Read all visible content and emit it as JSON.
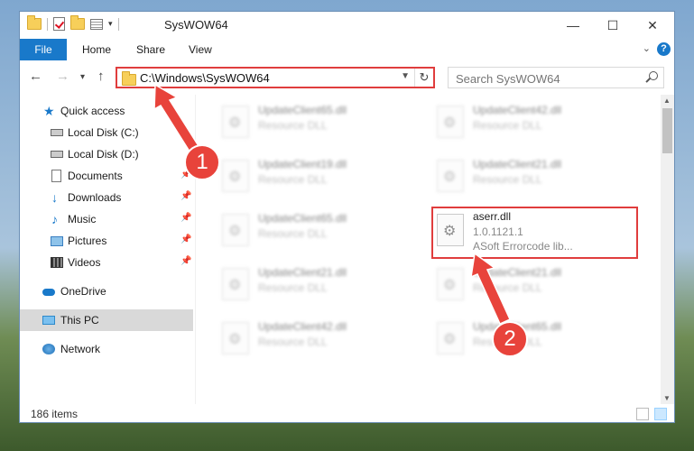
{
  "window": {
    "title": "SysWOW64",
    "controls": {
      "minimize": "—",
      "maximize": "☐",
      "close": "✕"
    }
  },
  "ribbon": {
    "tabs": [
      {
        "label": "File"
      },
      {
        "label": "Home"
      },
      {
        "label": "Share"
      },
      {
        "label": "View"
      }
    ],
    "help": "?"
  },
  "nav": {
    "address": "C:\\Windows\\SysWOW64",
    "search_placeholder": "Search SysWOW64"
  },
  "sidebar": {
    "items": [
      {
        "label": "Quick access",
        "icon": "star-icon"
      },
      {
        "label": "Local Disk (C:)",
        "icon": "drive-icon"
      },
      {
        "label": "Local Disk (D:)",
        "icon": "drive-icon"
      },
      {
        "label": "Documents",
        "icon": "documents-icon",
        "pinned": true
      },
      {
        "label": "Downloads",
        "icon": "download-icon",
        "pinned": true
      },
      {
        "label": "Music",
        "icon": "music-icon",
        "pinned": true
      },
      {
        "label": "Pictures",
        "icon": "pictures-icon",
        "pinned": true
      },
      {
        "label": "Videos",
        "icon": "videos-icon",
        "pinned": true
      },
      {
        "label": "OneDrive",
        "icon": "cloud-icon"
      },
      {
        "label": "This PC",
        "icon": "computer-icon",
        "selected": true
      },
      {
        "label": "Network",
        "icon": "network-icon"
      }
    ]
  },
  "files": [
    {
      "name": "UpdateClient65.dll",
      "type": "Resource DLL"
    },
    {
      "name": "UpdateClient42.dll",
      "type": "Resource DLL"
    },
    {
      "name": "UpdateClient19.dll",
      "type": "Resource DLL"
    },
    {
      "name": "UpdateClient21.dll",
      "type": "Resource DLL"
    },
    {
      "name": "UpdateClient65.dll",
      "type": "Resource DLL"
    },
    {
      "name": "aserr.dll",
      "version": "1.0.1121.1",
      "type": "ASoft Errorcode lib...",
      "highlighted": true
    },
    {
      "name": "UpdateClient21.dll",
      "type": "Resource DLL"
    },
    {
      "name": "UpdateClient21.dll",
      "type": "Resource DLL"
    },
    {
      "name": "UpdateClient42.dll",
      "type": "Resource DLL"
    },
    {
      "name": "UpdateClient65.dll",
      "type": "Resource DLL"
    }
  ],
  "status": {
    "item_count": "186 items"
  },
  "annotations": [
    {
      "number": "1",
      "color": "#e8433b"
    },
    {
      "number": "2",
      "color": "#e8433b"
    }
  ],
  "colors": {
    "accent": "#1979ca",
    "highlight": "#e03d3d",
    "marker": "#e8433b"
  }
}
